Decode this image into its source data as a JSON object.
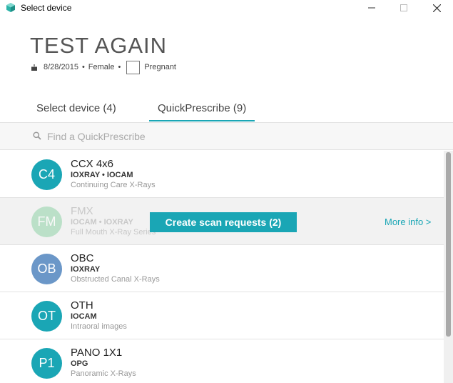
{
  "window": {
    "title": "Select device"
  },
  "patient": {
    "name": "TEST AGAIN",
    "dob": "8/28/2015",
    "sex": "Female",
    "separator": "•",
    "pregnant_label": "Pregnant"
  },
  "tabs": [
    {
      "label": "Select device (4)",
      "active": false
    },
    {
      "label": "QuickPrescribe (9)",
      "active": true
    }
  ],
  "search": {
    "placeholder": "Find a QuickPrescribe"
  },
  "list": [
    {
      "initials": "C4",
      "name": "CCX 4x6",
      "devices": "IOXRAY • IOCAM",
      "description": "Continuing Care X-Rays",
      "color": "#1aa6b5"
    },
    {
      "initials": "FM",
      "name": "FMX",
      "devices": "IOCAM • IOXRAY",
      "description": "Full Mouth X-Ray Series",
      "color": "#8fd3a6"
    },
    {
      "initials": "OB",
      "name": "OBC",
      "devices": "IOXRAY",
      "description": "Obstructed Canal X-Rays",
      "color": "#6b97c8"
    },
    {
      "initials": "OT",
      "name": "OTH",
      "devices": "IOCAM",
      "description": "Intraoral images",
      "color": "#1aa6b5"
    },
    {
      "initials": "P1",
      "name": "PANO 1X1",
      "devices": "OPG",
      "description": "Panoramic X-Rays",
      "color": "#1aa6b5"
    }
  ],
  "actions": {
    "create_label": "Create scan requests (2)",
    "more_info_label": "More info >"
  },
  "colors": {
    "accent": "#1aa6b5"
  }
}
